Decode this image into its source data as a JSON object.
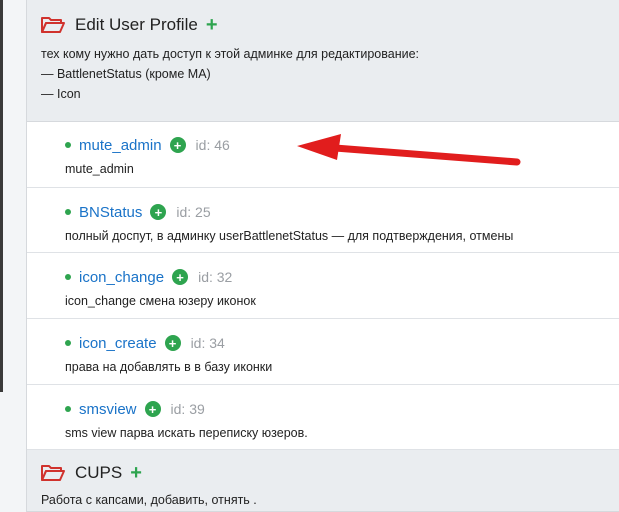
{
  "groups": [
    {
      "title": "Edit User Profile",
      "add_symbol": "+",
      "description_lines": [
        "тех кому нужно дать доступ к этой админке для редактирование:",
        "— BattlenetStatus (кроме  MA)",
        "— Icon"
      ],
      "permissions": [
        {
          "name": "mute_admin",
          "id": "id: 46",
          "description": "mute_admin"
        },
        {
          "name": "BNStatus",
          "id": "id: 25",
          "description": "полный доспут, в админку userBattlenetStatus — для подтверждения, отмены"
        },
        {
          "name": "icon_change",
          "id": "id: 32",
          "description": "icon_change смена юзеру иконок"
        },
        {
          "name": "icon_create",
          "id": "id: 34",
          "description": "права на добавлять в в базу иконки"
        },
        {
          "name": "smsview",
          "id": "id: 39",
          "description": "sms view парва искать переписку юзеров."
        }
      ]
    },
    {
      "title": "CUPS",
      "add_symbol": "+",
      "description_lines": [
        "Работа с капсами, добавить, отнять ."
      ]
    }
  ],
  "perm_add_symbol": "+",
  "icons": {
    "folder": "folder-open-icon",
    "add": "plus-icon",
    "perm_add": "plus-circle-icon",
    "bullet": "dot-icon",
    "annotation": "red-arrow"
  },
  "colors": {
    "accent_green": "#2ea44f",
    "link_blue": "#1a73c8",
    "folder_red": "#d0322d",
    "arrow_red": "#e11d1d",
    "group_bg": "#eaedf0"
  }
}
